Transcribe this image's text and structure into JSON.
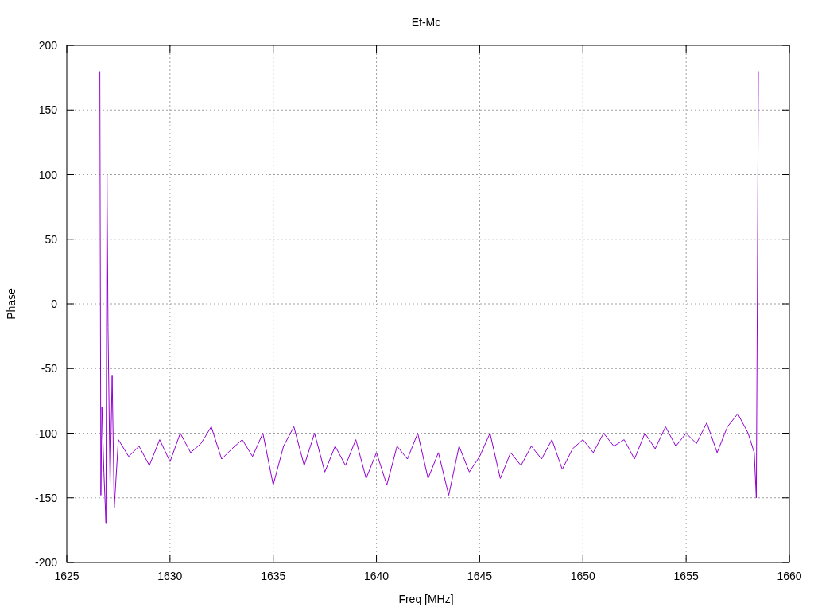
{
  "chart": {
    "chart_data": {
      "type": "line",
      "title": "Ef-Mc",
      "xlabel": "Freq [MHz]",
      "ylabel": "Phase",
      "xlim": [
        1625,
        1660
      ],
      "ylim": [
        -200,
        200
      ],
      "grid": true,
      "xticks": [
        1625,
        1630,
        1635,
        1640,
        1645,
        1650,
        1655,
        1660
      ],
      "yticks": [
        -200,
        -150,
        -100,
        -50,
        0,
        50,
        100,
        150,
        200
      ],
      "x": [
        1626.6,
        1626.65,
        1626.7,
        1626.8,
        1626.9,
        1626.95,
        1627.0,
        1627.1,
        1627.2,
        1627.3,
        1627.5,
        1628,
        1628.5,
        1629,
        1629.5,
        1630,
        1630.5,
        1631,
        1631.5,
        1632,
        1632.5,
        1633,
        1633.5,
        1634,
        1634.5,
        1635,
        1635.5,
        1636,
        1636.5,
        1637,
        1637.5,
        1638,
        1638.5,
        1639,
        1639.5,
        1640,
        1640.5,
        1641,
        1641.5,
        1642,
        1642.5,
        1643,
        1643.5,
        1644,
        1644.5,
        1645,
        1645.5,
        1646,
        1646.5,
        1647,
        1647.5,
        1648,
        1648.5,
        1649,
        1649.5,
        1650,
        1650.5,
        1651,
        1651.5,
        1652,
        1652.5,
        1653,
        1653.5,
        1654,
        1654.5,
        1655,
        1655.5,
        1656,
        1656.5,
        1657,
        1657.5,
        1658,
        1658.3,
        1658.4,
        1658.45,
        1658.5
      ],
      "series": [
        {
          "color": "#9400d3",
          "values": [
            180,
            -148,
            -80,
            -130,
            -170,
            100,
            -18,
            -140,
            -55,
            -158,
            -105,
            -118,
            -110,
            -125,
            -105,
            -122,
            -100,
            -115,
            -108,
            -95,
            -120,
            -112,
            -105,
            -118,
            -100,
            -140,
            -110,
            -95,
            -125,
            -100,
            -130,
            -110,
            -125,
            -105,
            -135,
            -115,
            -140,
            -110,
            -120,
            -100,
            -135,
            -115,
            -148,
            -110,
            -130,
            -118,
            -100,
            -135,
            -115,
            -125,
            -110,
            -120,
            -105,
            -128,
            -112,
            -105,
            -115,
            -100,
            -110,
            -105,
            -120,
            -100,
            -112,
            -95,
            -110,
            -100,
            -108,
            -92,
            -115,
            -95,
            -85,
            -100,
            -115,
            -150,
            5,
            180
          ]
        }
      ]
    }
  }
}
